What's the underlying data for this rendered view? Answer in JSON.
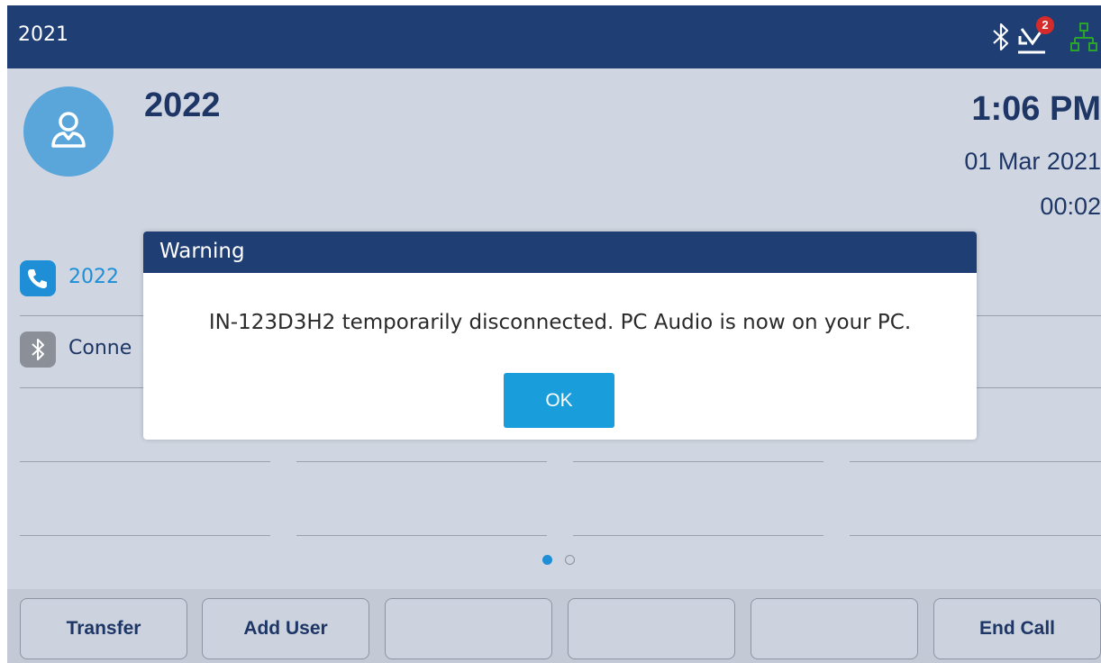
{
  "topbar": {
    "extension": "2021",
    "voicemail_count": "2",
    "icons": [
      "bluetooth-icon",
      "voicemail-icon",
      "network-icon"
    ],
    "bar_color": "#1f3e74",
    "network_color": "#2aa42a"
  },
  "call": {
    "caller_name": "2022",
    "time": "1:06 PM",
    "date": "01 Mar 2021",
    "duration": "00:02"
  },
  "line_keys": [
    {
      "label": "2022",
      "icon": "phone-icon"
    },
    {
      "label": "Conne",
      "icon": "bluetooth-icon"
    }
  ],
  "pagination": {
    "pages": 2,
    "current": 1
  },
  "softkeys": [
    {
      "label": "Transfer"
    },
    {
      "label": "Add User"
    },
    {
      "label": ""
    },
    {
      "label": ""
    },
    {
      "label": ""
    },
    {
      "label": "End Call"
    }
  ],
  "dialog": {
    "title": "Warning",
    "message": "IN-123D3H2 temporarily disconnected. PC Audio is now on your PC.",
    "ok_label": "OK",
    "button_color": "#1a9ddb"
  }
}
